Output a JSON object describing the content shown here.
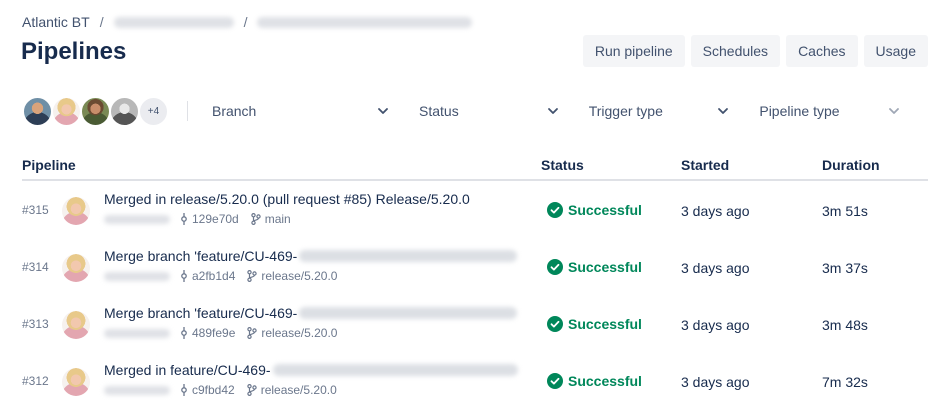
{
  "breadcrumb": {
    "workspace": "Atlantic BT",
    "separator": "/"
  },
  "page": {
    "title": "Pipelines"
  },
  "actions": {
    "run_pipeline": "Run pipeline",
    "schedules": "Schedules",
    "caches": "Caches",
    "usage": "Usage"
  },
  "filters": {
    "more_avatars": "+4",
    "branch": "Branch",
    "status": "Status",
    "trigger_type": "Trigger type",
    "pipeline_type": "Pipeline type"
  },
  "table": {
    "headers": {
      "pipeline": "Pipeline",
      "status": "Status",
      "started": "Started",
      "duration": "Duration"
    },
    "rows": [
      {
        "number": "#315",
        "message": "Merged in release/5.20.0 (pull request #85) Release/5.20.0",
        "commit": "129e70d",
        "branch": "main",
        "status": "Successful",
        "started": "3 days ago",
        "duration": "3m 51s"
      },
      {
        "number": "#314",
        "message": "Merge branch 'feature/CU-469-",
        "commit": "a2fb1d4",
        "branch": "release/5.20.0",
        "status": "Successful",
        "started": "3 days ago",
        "duration": "3m 37s"
      },
      {
        "number": "#313",
        "message": "Merge branch 'feature/CU-469-",
        "commit": "489fe9e",
        "branch": "release/5.20.0",
        "status": "Successful",
        "started": "3 days ago",
        "duration": "3m 48s"
      },
      {
        "number": "#312",
        "message": "Merged in feature/CU-469-",
        "commit": "c9fbd42",
        "branch": "release/5.20.0",
        "status": "Successful",
        "started": "3 days ago",
        "duration": "7m 32s"
      }
    ]
  },
  "colors": {
    "success": "#00875a",
    "text": "#172b4d",
    "muted": "#6b778c",
    "button_bg": "#f4f5f7"
  }
}
